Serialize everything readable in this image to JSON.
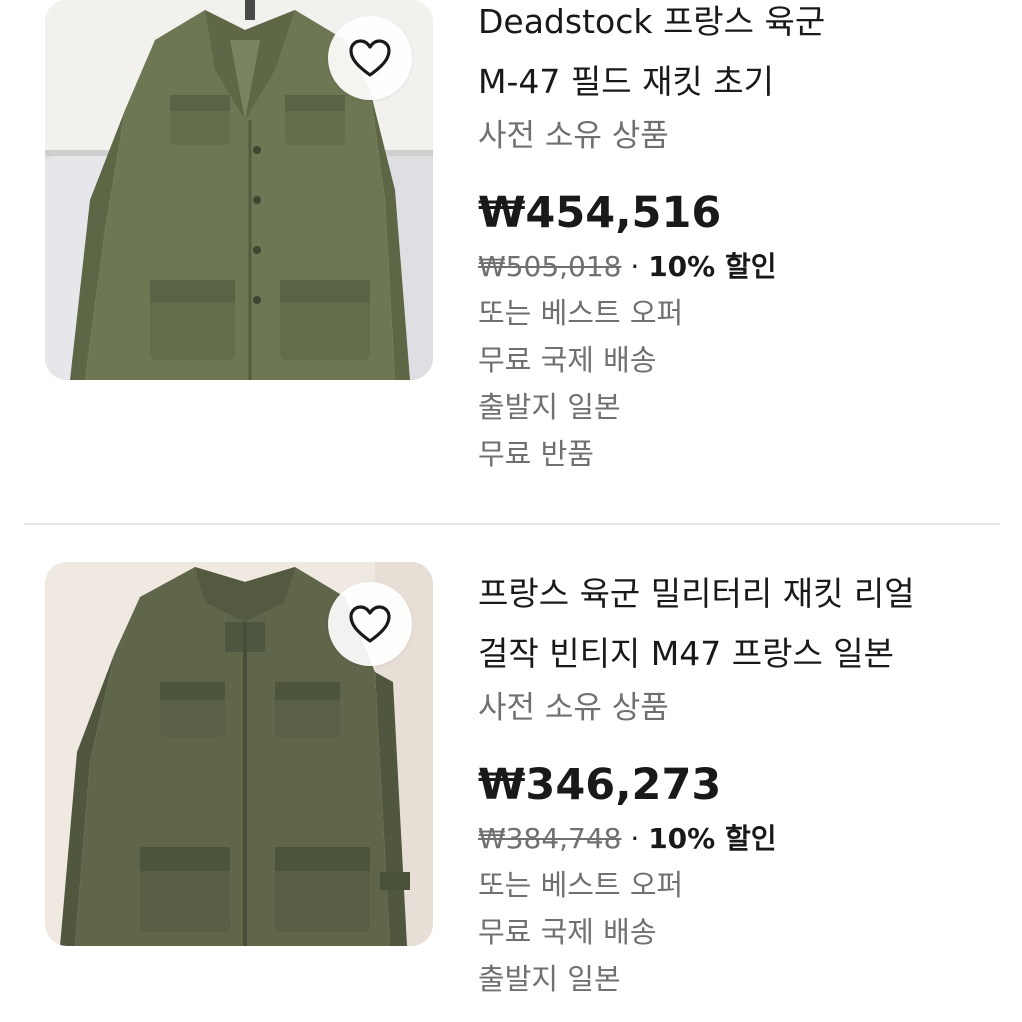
{
  "listings": [
    {
      "title_line1": "Deadstock 프랑스 육군",
      "title_line2": "M-47 필드 재킷 초기",
      "condition": "사전 소유 상품",
      "price": "₩454,516",
      "original_price": "₩505,018",
      "separator": " · ",
      "discount": "10% 할인",
      "offer": "또는 베스트 오퍼",
      "shipping": "무료 국제 배송",
      "origin": "출발지 일본",
      "returns": "무료 반품",
      "image_alt": "olive green field jacket hanging",
      "watch_icon": "heart-icon"
    },
    {
      "title_line1": "프랑스 육군 밀리터리 재킷 리얼",
      "title_line2": "걸작 빈티지 M47 프랑스 일본",
      "condition": "사전 소유 상품",
      "price": "₩346,273",
      "original_price": "₩384,748",
      "separator": " · ",
      "discount": "10% 할인",
      "offer": "또는 베스트 오퍼",
      "shipping": "무료 국제 배송",
      "origin": "출발지 일본",
      "image_alt": "olive military jacket on hanger",
      "watch_icon": "heart-icon"
    }
  ],
  "colors": {
    "text_primary": "#191919",
    "text_secondary": "#707070",
    "divider": "#e5e5e5",
    "olive": "#6b7452"
  }
}
